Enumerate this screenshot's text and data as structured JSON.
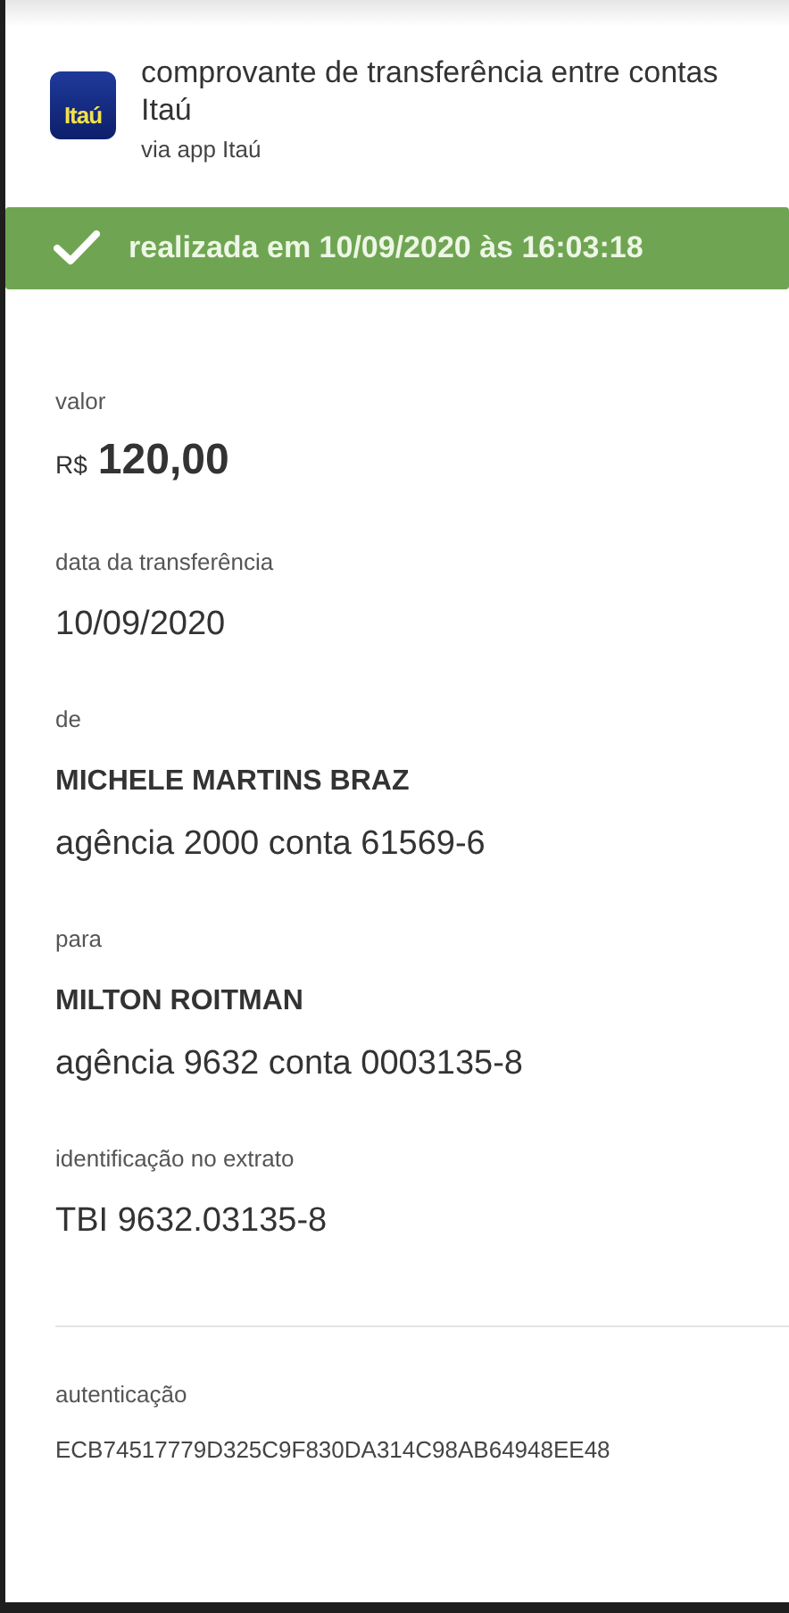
{
  "header": {
    "logo_text": "Itaú",
    "title": "comprovante de transferência entre contas Itaú",
    "subtitle": "via app Itaú"
  },
  "status_banner": {
    "text": "realizada em 10/09/2020 às 16:03:18"
  },
  "fields": [
    {
      "kind": "amount",
      "label": "valor",
      "currency": "R$",
      "value": "120,00"
    },
    {
      "kind": "text",
      "label": "data da transferência",
      "value": "10/09/2020"
    },
    {
      "kind": "party",
      "label": "de",
      "name": "MICHELE MARTINS BRAZ",
      "account": "agência 2000 conta 61569-6"
    },
    {
      "kind": "party",
      "label": "para",
      "name": "MILTON ROITMAN",
      "account": "agência 9632 conta 0003135-8"
    },
    {
      "kind": "text",
      "label": "identificação no extrato",
      "value": "TBI 9632.03135-8"
    }
  ],
  "authentication": {
    "label": "autenticação",
    "value": "ECB74517779D325C9F830DA314C98AB64948EE48"
  }
}
